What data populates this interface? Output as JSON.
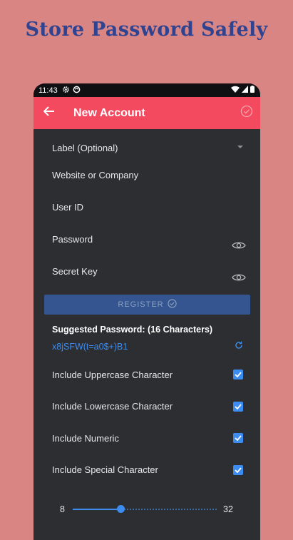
{
  "headline": "Store Password Safely",
  "status": {
    "time": "11:43"
  },
  "appbar": {
    "title": "New Account"
  },
  "form": {
    "label_field": "Label (Optional)",
    "website": "Website or Company",
    "user_id": "User ID",
    "password": "Password",
    "secret_key": "Secret Key"
  },
  "register_label": "REGISTER",
  "suggested": {
    "title": "Suggested Password: (16 Characters)",
    "password": "x8jSFW(t=a0$+)B1"
  },
  "options": [
    {
      "label": "Include Uppercase Character",
      "checked": true
    },
    {
      "label": "Include Lowercase Character",
      "checked": true
    },
    {
      "label": "Include Numeric",
      "checked": true
    },
    {
      "label": "Include Special Character",
      "checked": true
    }
  ],
  "length_slider": {
    "min": "8",
    "max": "32",
    "value": 16
  },
  "colors": {
    "accent": "#3d8cf0",
    "appbar": "#f34a5f",
    "background": "#d98583",
    "headline": "#2f4391"
  }
}
